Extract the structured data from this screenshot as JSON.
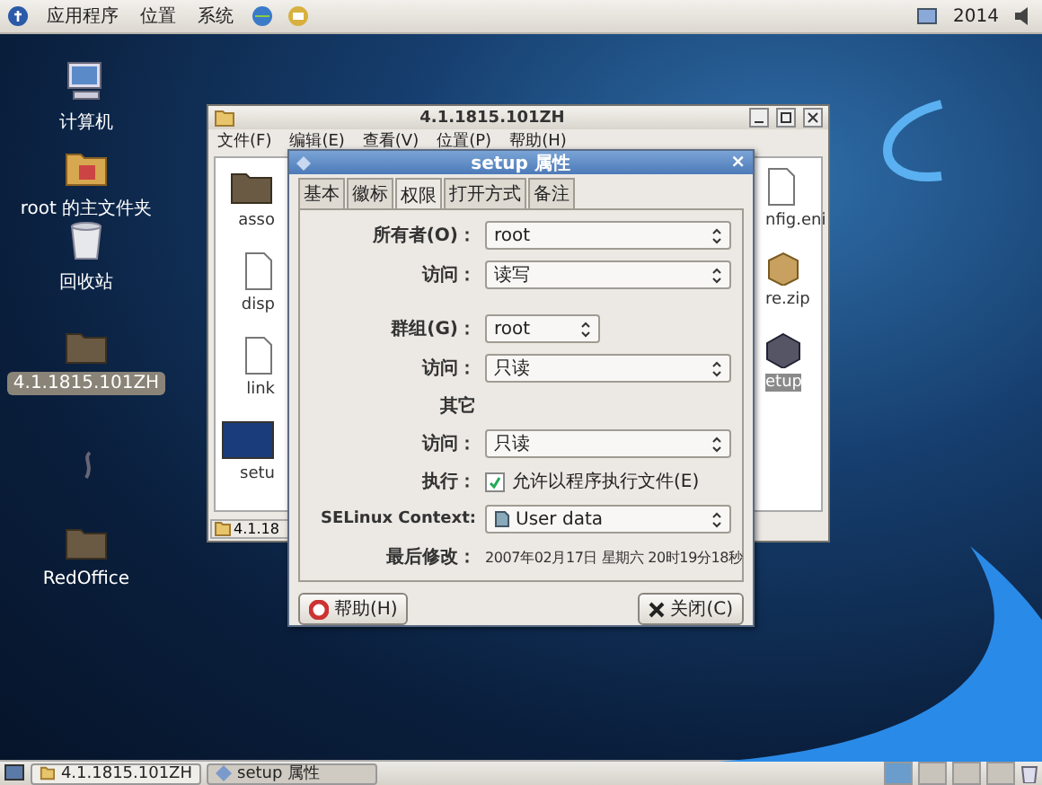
{
  "top_panel": {
    "menus": [
      "应用程序",
      "位置",
      "系统"
    ],
    "clock": "2014"
  },
  "desktop_icons": [
    {
      "label": "计算机",
      "kind": "computer",
      "selected": false
    },
    {
      "label": "root 的主文件夹",
      "kind": "home",
      "selected": false
    },
    {
      "label": "回收站",
      "kind": "trash",
      "selected": false
    },
    {
      "label": "4.1.1815.101ZH",
      "kind": "folder",
      "selected": true
    },
    {
      "label": "RedOffice",
      "kind": "folder",
      "selected": false
    }
  ],
  "file_window": {
    "title": "4.1.1815.101ZH",
    "menus": [
      "文件(F)",
      "编辑(E)",
      "查看(V)",
      "位置(P)",
      "帮助(H)"
    ],
    "files_left": [
      {
        "label": "asso",
        "kind": "folder",
        "selected": false
      },
      {
        "label": "disp",
        "kind": "doc",
        "selected": false
      },
      {
        "label": "link",
        "kind": "doc",
        "selected": false
      },
      {
        "label": "setu",
        "kind": "image",
        "selected": false
      }
    ],
    "files_right": [
      {
        "label": "nfig.eni",
        "kind": "doc",
        "selected": false
      },
      {
        "label": "re.zip",
        "kind": "box",
        "selected": false
      },
      {
        "label": "etup",
        "kind": "app",
        "selected": true
      }
    ],
    "status": "4.1.18"
  },
  "dialog": {
    "title": "setup 属性",
    "close": "×",
    "tabs": [
      {
        "label": "基本",
        "selected": false
      },
      {
        "label": "徽标",
        "selected": false
      },
      {
        "label": "权限",
        "selected": true
      },
      {
        "label": "打开方式",
        "selected": false
      },
      {
        "label": "备注",
        "selected": false
      }
    ],
    "rows": [
      {
        "kind": "combo",
        "label": "所有者(O)：",
        "value": "root",
        "wide": true
      },
      {
        "kind": "combo",
        "label": "访问：",
        "value": "读写",
        "wide": true
      },
      {
        "kind": "gap"
      },
      {
        "kind": "combo",
        "label": "群组(G)：",
        "value": "root",
        "wide": false
      },
      {
        "kind": "combo",
        "label": "访问：",
        "value": "只读",
        "wide": true
      },
      {
        "kind": "heading",
        "label": "其它"
      },
      {
        "kind": "combo",
        "label": "访问：",
        "value": "只读",
        "wide": true
      },
      {
        "kind": "check",
        "label": "执行：",
        "value": "允许以程序执行文件(E)",
        "checked": true
      },
      {
        "kind": "combo",
        "label": "SELinux Context:",
        "value": "User data",
        "wide": true,
        "icon": true
      },
      {
        "kind": "text",
        "label": "最后修改：",
        "value": "2007年02月17日 星期六 20时19分18秒"
      }
    ],
    "buttons": [
      {
        "label": "帮助(H)",
        "kind": "help"
      },
      {
        "label": "关闭(C)",
        "kind": "close"
      }
    ]
  },
  "taskbar": {
    "tasks": [
      {
        "label": "4.1.1815.101ZH",
        "kind": "folder",
        "selected": false
      },
      {
        "label": "setup 属性",
        "kind": "props",
        "selected": true
      }
    ],
    "workspaces": [
      {
        "selected": true
      },
      {
        "selected": false
      },
      {
        "selected": false
      },
      {
        "selected": false
      }
    ]
  }
}
